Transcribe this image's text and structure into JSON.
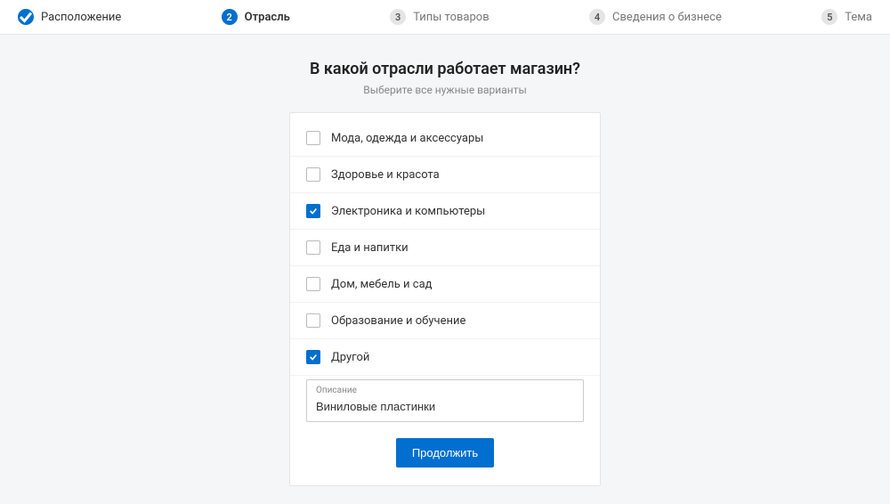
{
  "stepper": {
    "steps": [
      {
        "label": "Расположение",
        "state": "done"
      },
      {
        "label": "Отрасль",
        "state": "current",
        "num": "2"
      },
      {
        "label": "Типы товаров",
        "state": "future",
        "num": "3"
      },
      {
        "label": "Сведения о бизнесе",
        "state": "future",
        "num": "4"
      },
      {
        "label": "Тема",
        "state": "future",
        "num": "5"
      }
    ]
  },
  "title": "В какой отрасли работает магазин?",
  "subtitle": "Выберите все нужные варианты",
  "options": [
    {
      "label": "Мода, одежда и аксессуары",
      "checked": false
    },
    {
      "label": "Здоровье и красота",
      "checked": false
    },
    {
      "label": "Электроника и компьютеры",
      "checked": true
    },
    {
      "label": "Еда и напитки",
      "checked": false
    },
    {
      "label": "Дом, мебель и сад",
      "checked": false
    },
    {
      "label": "Образование и обучение",
      "checked": false
    },
    {
      "label": "Другой",
      "checked": true
    }
  ],
  "other_input": {
    "label": "Описание",
    "value": "Виниловые пластинки"
  },
  "continue_label": "Продолжить"
}
